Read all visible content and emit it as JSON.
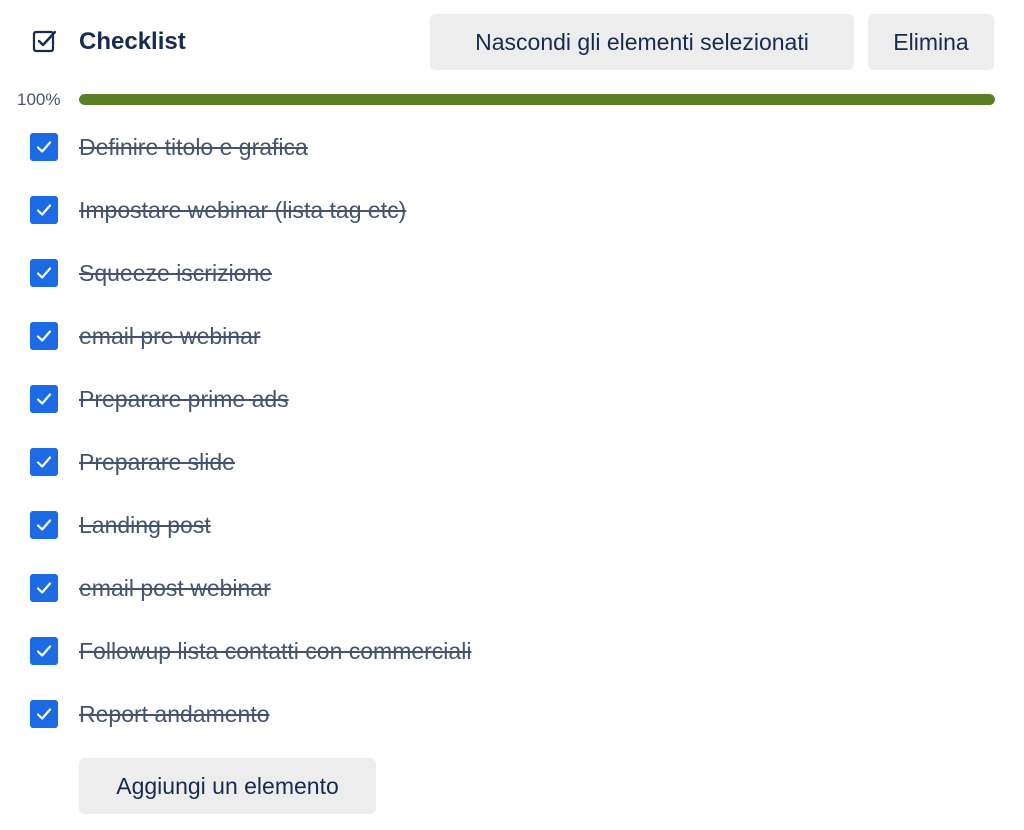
{
  "header": {
    "title": "Checklist",
    "hide_checked_label": "Nascondi gli elementi selezionati",
    "delete_label": "Elimina"
  },
  "progress": {
    "label": "100%",
    "value": 1.0,
    "color": "#5b7f24"
  },
  "items": [
    {
      "label": "Definire titolo e grafica",
      "checked": true
    },
    {
      "label": "Impostare webinar (lista tag etc)",
      "checked": true
    },
    {
      "label": "Squeeze iscrizione",
      "checked": true
    },
    {
      "label": "email pre webinar",
      "checked": true
    },
    {
      "label": "Preparare prime ads",
      "checked": true
    },
    {
      "label": "Preparare slide",
      "checked": true
    },
    {
      "label": "Landing post",
      "checked": true
    },
    {
      "label": "email post webinar",
      "checked": true
    },
    {
      "label": "Followup lista contatti con commerciali",
      "checked": true
    },
    {
      "label": "Report andamento",
      "checked": true
    }
  ],
  "footer": {
    "add_item_label": "Aggiungi un elemento"
  },
  "colors": {
    "checkbox": "#1d6ae5",
    "button_bg": "#ededed"
  },
  "icons": {
    "header": "checklist-icon",
    "checkbox": "checkmark-icon"
  }
}
